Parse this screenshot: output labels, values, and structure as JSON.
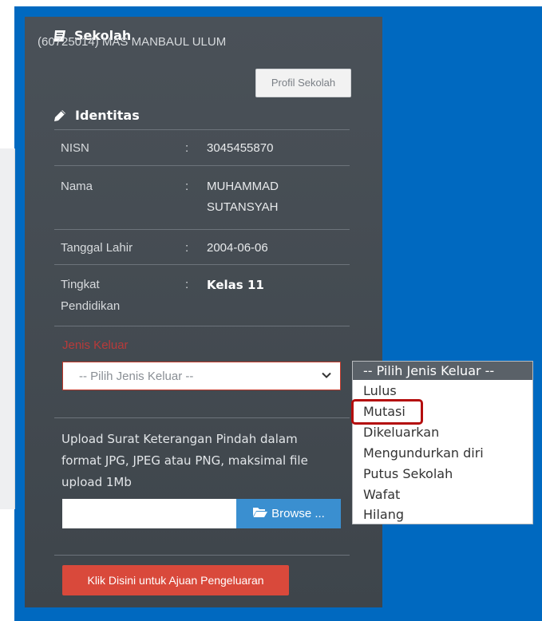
{
  "school": {
    "title": "Sekolah",
    "name": "(60725014) MAS MANBAUL ULUM",
    "profile_button": "Profil Sekolah"
  },
  "identity": {
    "title": "Identitas",
    "rows": [
      {
        "label": "NISN",
        "colon": ":",
        "value": "3045455870"
      },
      {
        "label": "Nama",
        "colon": ":",
        "value_line1": "MUHAMMAD",
        "value_line2": "SUTANSYAH"
      },
      {
        "label": "Tanggal Lahir",
        "colon": ":",
        "value": "2004-06-06"
      },
      {
        "label_line1": "Tingkat",
        "label_line2": "Pendidikan",
        "colon": ":",
        "value": "Kelas 11"
      }
    ]
  },
  "exit_type": {
    "label": "Jenis Keluar",
    "selected": "-- Pilih Jenis Keluar --",
    "options": [
      "-- Pilih Jenis Keluar --",
      "Lulus",
      "Mutasi",
      "Dikeluarkan",
      "Mengundurkan diri",
      "Putus Sekolah",
      "Wafat",
      "Hilang"
    ],
    "highlighted_option": "Mutasi"
  },
  "upload": {
    "line1": "Upload Surat Keterangan Pindah dalam",
    "line2": "format JPG, JPEG atau PNG, maksimal file",
    "line3": "upload 1Mb",
    "browse_label": "Browse ..."
  },
  "submit_label": "Klik Disini untuk Ajuan Pengeluaran",
  "colors": {
    "background_blue": "#0069c0",
    "card": "#454c53",
    "submit": "#d9493b",
    "browse": "#3a8fd0",
    "highlight": "#b40e0e"
  },
  "icons": [
    "book-icon",
    "pencil-icon",
    "chevron-down-icon",
    "folder-open-icon"
  ]
}
